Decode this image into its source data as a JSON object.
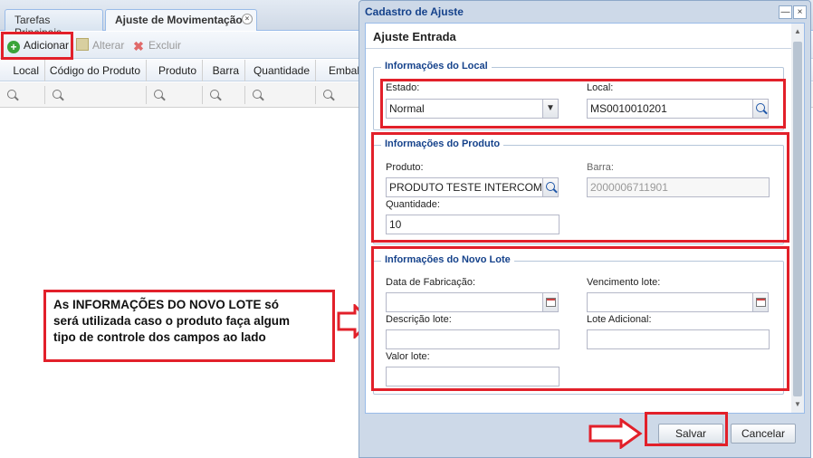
{
  "tabs": {
    "main": "Tarefas Principais",
    "active": "Ajuste de Movimentação",
    "close": "×"
  },
  "toolbar": {
    "add_icon": "+",
    "add": "Adicionar",
    "edit": "Alterar",
    "delete_icon": "✖",
    "delete": "Excluir"
  },
  "grid": {
    "columns": [
      "Local",
      "Código do Produto",
      "Produto",
      "Barra",
      "Quantidade",
      "Embala"
    ]
  },
  "window": {
    "title": "Cadastro de Ajuste",
    "minimize": "—",
    "close": "×",
    "panel_title": "Ajuste Entrada",
    "scroll_up": "▲",
    "scroll_down": "▼"
  },
  "local_section": {
    "legend": "Informações do Local",
    "estado_label": "Estado:",
    "estado_value": "Normal",
    "estado_arrow": "▼",
    "local_label": "Local:",
    "local_value": "MS0010010201"
  },
  "produto_section": {
    "legend": "Informações do Produto",
    "produto_label": "Produto:",
    "produto_value": "PRODUTO TESTE INTERCOMPA",
    "barra_label": "Barra:",
    "barra_value": "2000006711901",
    "quantidade_label": "Quantidade:",
    "quantidade_value": "10"
  },
  "lote_section": {
    "legend": "Informações do Novo Lote",
    "fabricacao_label": "Data de Fabricação:",
    "vencimento_label": "Vencimento lote:",
    "descricao_label": "Descrição lote:",
    "adicional_label": "Lote Adicional:",
    "valor_label": "Valor lote:"
  },
  "buttons": {
    "save": "Salvar",
    "cancel": "Cancelar"
  },
  "annotation": {
    "line1": "As INFORMAÇÕES DO NOVO LOTE só",
    "line2": "será utilizada caso o produto faça algum",
    "line3": "tipo de controle dos campos ao lado"
  },
  "colors": {
    "highlight": "#e2202a",
    "header_blue": "#15428b"
  }
}
